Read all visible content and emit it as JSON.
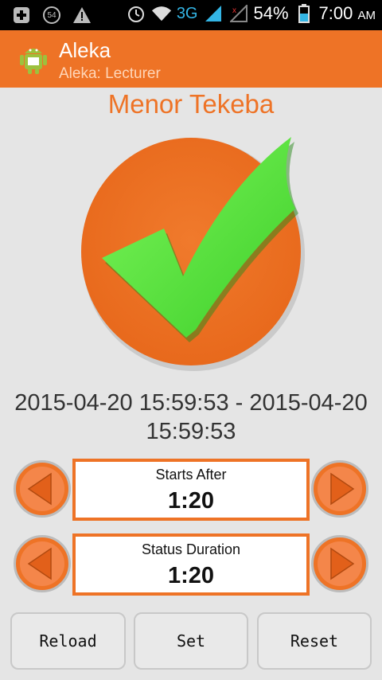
{
  "status_bar": {
    "notification_badge": "54",
    "network": "3G",
    "battery": "54%",
    "time": "7:00",
    "ampm": "AM"
  },
  "app_bar": {
    "title": "Aleka",
    "subtitle": "Aleka: Lecturer"
  },
  "person_name": "Menor Tekeba",
  "date_range": "2015-04-20 15:59:53 - 2015-04-20 15:59:53",
  "timers": [
    {
      "label": "Starts After",
      "value": "1:20"
    },
    {
      "label": "Status Duration",
      "value": "1:20"
    }
  ],
  "buttons": {
    "reload": "Reload",
    "set": "Set",
    "reset": "Reset"
  },
  "colors": {
    "accent": "#ee7326",
    "check": "#55e23a"
  }
}
